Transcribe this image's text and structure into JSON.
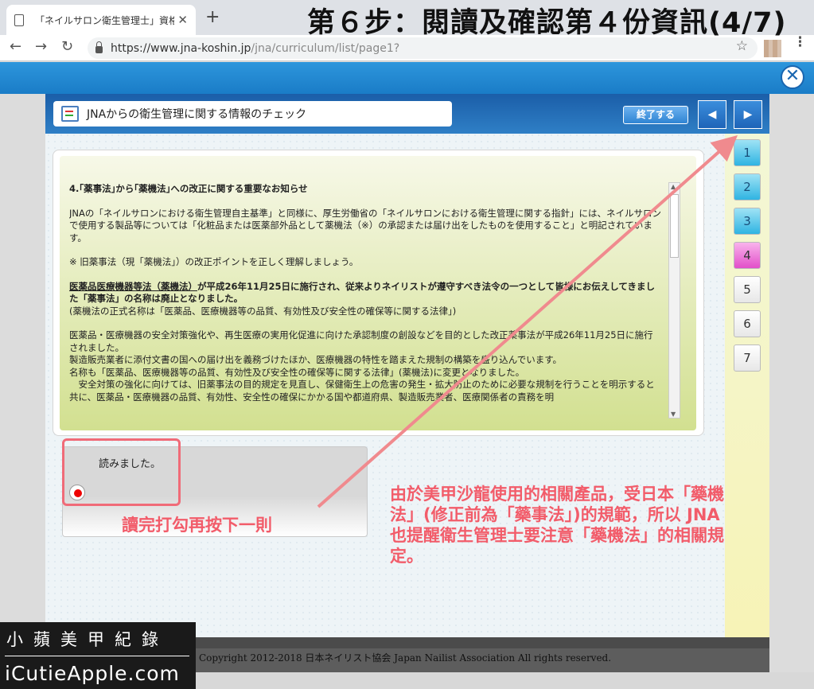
{
  "browser": {
    "tab_title": "「ネイルサロン衛生管理士」資格",
    "tab_close": "✕",
    "new_tab": "+",
    "url_host": "https://www.jna-koshin.jp",
    "url_path": "/jna/curriculum/list/page1?",
    "back": "←",
    "forward": "→",
    "reload": "↻",
    "star": "☆",
    "menu": "⋮"
  },
  "overlay_title": "第６步：閱讀及確認第４份資訊(4/7)",
  "app": {
    "close_icon": "✕",
    "lesson_title": "JNAからの衛生管理に関する情報のチェック",
    "end_button": "終了する",
    "prev": "◀",
    "next": "▶",
    "pages": [
      {
        "label": "1",
        "state": "done"
      },
      {
        "label": "2",
        "state": "done"
      },
      {
        "label": "3",
        "state": "done"
      },
      {
        "label": "4",
        "state": "current"
      },
      {
        "label": "5",
        "state": "todo"
      },
      {
        "label": "6",
        "state": "todo"
      },
      {
        "label": "7",
        "state": "todo"
      }
    ]
  },
  "article": {
    "heading": "4.｢薬事法｣から｢薬機法｣への改正に関する重要なお知らせ",
    "p1": "JNAの「ネイルサロンにおける衛生管理自主基準」と同様に、厚生労働省の「ネイルサロンにおける衛生管理に関する指針」には、ネイルサロンで使用する製品等については「化粧品または医薬部外品として薬機法（※）の承認または届け出をしたものを使用すること」と明記されています。",
    "p2": "※ 旧薬事法（現「薬機法」）の改正ポイントを正しく理解しましょう。",
    "p3_u": "医薬品医療機器等法（薬機法）",
    "p3_b": "が平成26年11月25日に施行され、従来よりネイリストが遵守すべき法令の一つとして皆様にお伝えしてきました「薬事法」の名称は廃止となりました。",
    "p3_n": "(薬機法の正式名称は「医薬品、医療機器等の品質、有効性及び安全性の確保等に関する法律」)",
    "p4a": "医薬品・医療機器の安全対策強化や、再生医療の実用化促進に向けた承認制度の創設などを目的とした改正薬事法が平成26年11月25日に施行されました。",
    "p4b": "製造販売業者に添付文書の国への届け出を義務づけたほか、医療機器の特性を踏まえた規制の構築を盛り込んでいます。",
    "p4c": "名称も「医薬品、医療機器等の品質、有効性及び安全性の確保等に関する法律」(薬機法)に変更となりました。",
    "p4d": "　安全対策の強化に向けては、旧薬事法の目的規定を見直し、保健衛生上の危害の発生・拡大防止のために必要な規制を行うことを明示すると共に、医薬品・医療機器の品質、有効性、安全性の確保にかかる国や都道府県、製造販売業者、医療関係者の責務を明"
  },
  "read_check": {
    "label": "読みました。",
    "checked": true
  },
  "annotations": {
    "left": "讀完打勾再按下一則",
    "right": "由於美甲沙龍使用的相關產品，受日本「藥機法」(修正前為「藥事法」)的規範，所以 JNA 也提醒衛生管理士要注意「藥機法」的相關規定。",
    "color": "#f25c6a"
  },
  "footer": {
    "copyright": "Copyright 2012-2018 日本ネイリスト協会 Japan Nailist Association All rights reserved."
  },
  "watermark": {
    "line1": "小蘋美甲紀錄",
    "line2": "iCutieApple.com"
  }
}
